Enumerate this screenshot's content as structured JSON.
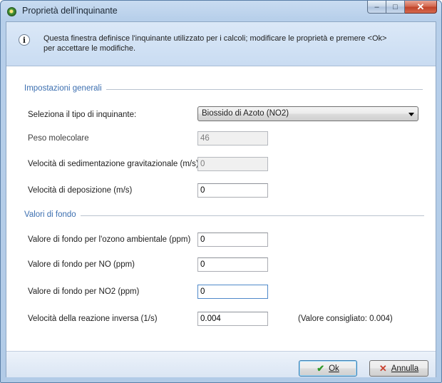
{
  "window": {
    "title": "Proprietà dell'inquinante",
    "icon": "pollutant-app-icon",
    "controls": {
      "minimize": "–",
      "maximize": "□",
      "close": "✕"
    }
  },
  "info": {
    "icon": "info-icon",
    "text": "Questa finestra definisce l'inquinante utilizzato per i calcoli; modificare le proprietà e premere <Ok> per accettare le modifiche."
  },
  "general": {
    "title": "Impostazioni generali",
    "pollutant_label": "Seleziona il tipo di inquinante:",
    "pollutant_value": "Biossido di Azoto (NO2)",
    "molecular_weight_label": "Peso molecolare",
    "molecular_weight_value": "46",
    "sedimentation_label": "Velocità di sedimentazione gravitazionale (m/s)",
    "sedimentation_value": "0",
    "deposition_label": "Velocità di deposizione (m/s)",
    "deposition_value": "0"
  },
  "background": {
    "title": "Valori di fondo",
    "ozone_label": "Valore di fondo per l'ozono ambientale (ppm)",
    "ozone_value": "0",
    "no_label": "Valore di fondo per  NO (ppm)",
    "no_value": "0",
    "no2_label": "Valore di fondo per  NO2 (ppm)",
    "no2_value": "0",
    "reverse_rate_label": "Velocità della reazione inversa (1/s)",
    "reverse_rate_value": "0.004",
    "recommended_note": "(Valore consigliato: 0.004)"
  },
  "buttons": {
    "ok_label": "Ok",
    "cancel_label": "Annulla"
  }
}
